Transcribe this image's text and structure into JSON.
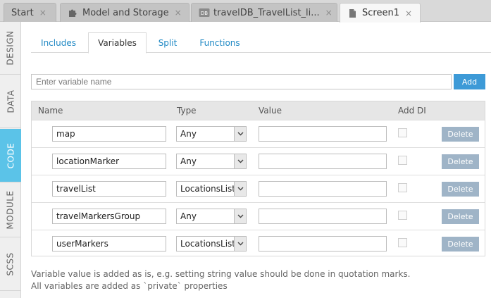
{
  "file_tabs": [
    {
      "label": "Start",
      "icon": "none"
    },
    {
      "label": "Model and Storage",
      "icon": "puzzle-icon"
    },
    {
      "label": "travelDB_TravelList_li...",
      "icon": "database-icon"
    },
    {
      "label": "Screen1",
      "icon": "file-icon"
    }
  ],
  "file_tab_close": "×",
  "sidebar": {
    "items": [
      {
        "label": "DESIGN"
      },
      {
        "label": "DATA"
      },
      {
        "label": "CODE"
      },
      {
        "label": "MODULE"
      },
      {
        "label": "SCSS"
      }
    ],
    "active": "CODE"
  },
  "subtabs": [
    {
      "label": "Includes"
    },
    {
      "label": "Variables"
    },
    {
      "label": "Split"
    },
    {
      "label": "Functions"
    }
  ],
  "active_subtab": "Variables",
  "add_variable": {
    "placeholder": "Enter variable name",
    "value": "",
    "button": "Add"
  },
  "table": {
    "headers": {
      "name": "Name",
      "type": "Type",
      "value": "Value",
      "add_di": "Add DI"
    },
    "rows": [
      {
        "name": "map",
        "type": "Any",
        "value": "",
        "add_di": false,
        "action": "Delete"
      },
      {
        "name": "locationMarker",
        "type": "Any",
        "value": "",
        "add_di": false,
        "action": "Delete"
      },
      {
        "name": "travelList",
        "type": "LocationsList",
        "value": "",
        "add_di": false,
        "action": "Delete"
      },
      {
        "name": "travelMarkersGroup",
        "type": "Any",
        "value": "",
        "add_di": false,
        "action": "Delete"
      },
      {
        "name": "userMarkers",
        "type": "LocationsList",
        "value": "",
        "add_di": false,
        "action": "Delete"
      }
    ]
  },
  "notes": {
    "line1": "Variable value is added as is, e.g. setting string value should be done in quotation marks.",
    "line2": "All variables are added as `private` properties"
  },
  "colors": {
    "accent": "#5bc3e8",
    "add_button": "#3d9ad7",
    "delete_button": "#9fb4c7",
    "link": "#1e88c4"
  }
}
